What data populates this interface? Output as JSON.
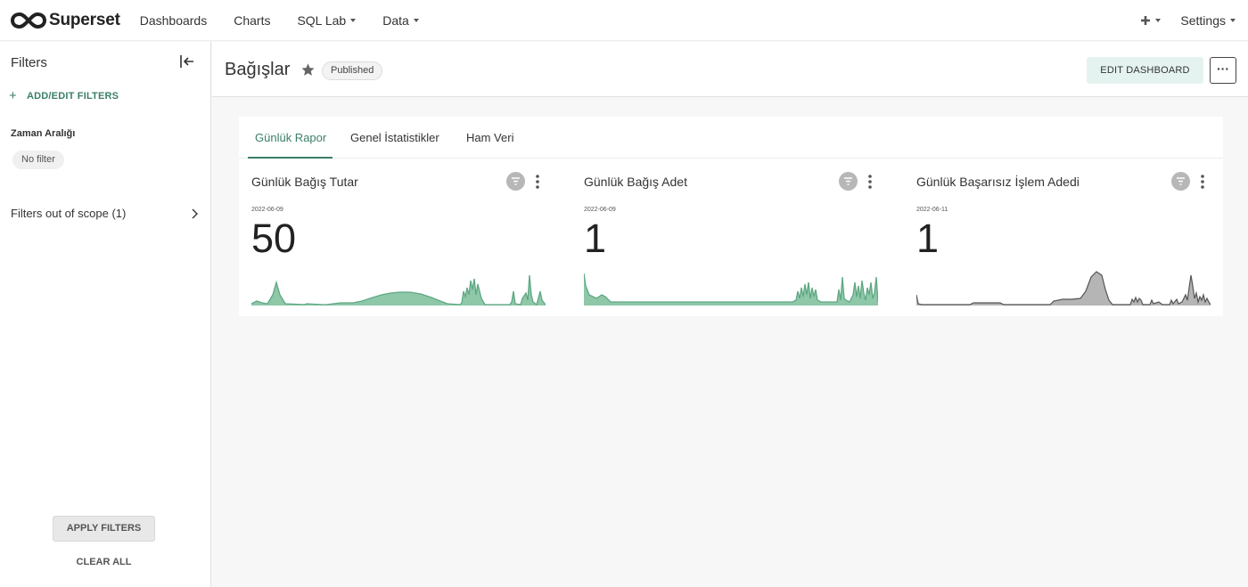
{
  "brand": {
    "name": "Superset"
  },
  "nav": {
    "items": [
      {
        "label": "Dashboards",
        "has_caret": false
      },
      {
        "label": "Charts",
        "has_caret": false
      },
      {
        "label": "SQL Lab",
        "has_caret": true
      },
      {
        "label": "Data",
        "has_caret": true
      }
    ],
    "settings_label": "Settings",
    "plus_icon": "plus-icon"
  },
  "filters": {
    "title": "Filters",
    "add_label": "ADD/EDIT FILTERS",
    "filter_name": "Zaman Aralığı",
    "filter_value": "No filter",
    "out_of_scope": "Filters out of scope (1)",
    "apply_label": "APPLY FILTERS",
    "clear_label": "CLEAR ALL"
  },
  "dashboard": {
    "title": "Bağışlar",
    "status": "Published",
    "edit_label": "EDIT DASHBOARD",
    "more_label": "···"
  },
  "tabs": [
    {
      "label": "Günlük Rapor",
      "active": true
    },
    {
      "label": "Genel İstatistikler",
      "active": false
    },
    {
      "label": "Ham Veri",
      "active": false
    }
  ],
  "charts": [
    {
      "title": "Günlük Bağış Tutar",
      "date": "2022-06-09",
      "value": "50",
      "color": "#5fa883"
    },
    {
      "title": "Günlük Bağış Adet",
      "date": "2022-06-09",
      "value": "1",
      "color": "#5fa883"
    },
    {
      "title": "Günlük Başarısız İşlem Adedi",
      "date": "2022-06-11",
      "value": "1",
      "color": "#555555"
    }
  ],
  "colors": {
    "accent": "#3b7f66",
    "spark_green": "#5fa883",
    "spark_gray": "#555555"
  }
}
